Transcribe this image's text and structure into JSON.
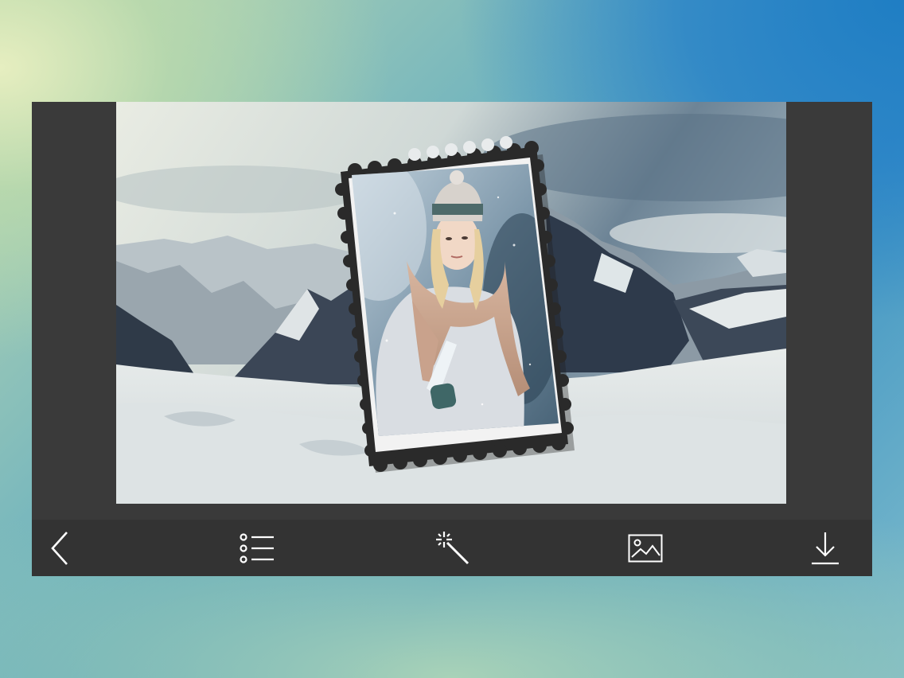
{
  "app": {
    "frame_color": "#3a3a3a",
    "toolbar_color": "#333333",
    "icon_color": "#ffffff"
  },
  "canvas": {
    "background_image": "snowy-mountain-landscape",
    "overlay_frame": "postage-stamp-frame",
    "portrait": "woman-in-winter-hat-and-scarf"
  },
  "toolbar": {
    "items": [
      {
        "icon": "back-icon"
      },
      {
        "icon": "list-icon"
      },
      {
        "icon": "magic-wand-icon"
      },
      {
        "icon": "image-icon"
      },
      {
        "icon": "download-icon"
      }
    ]
  }
}
